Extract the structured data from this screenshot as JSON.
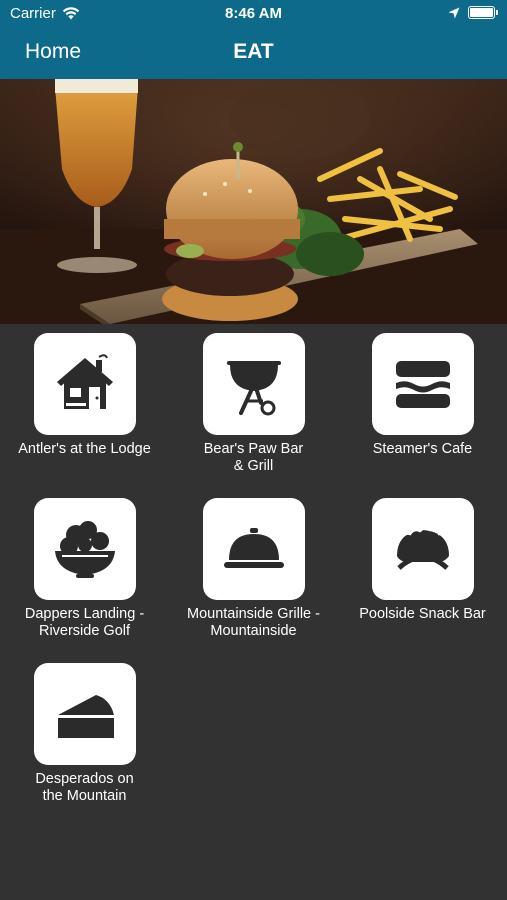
{
  "status_bar": {
    "carrier": "Carrier",
    "time": "8:46 AM"
  },
  "nav": {
    "back_label": "Home",
    "title": "EAT"
  },
  "colors": {
    "nav_bg": "#0e6a8a",
    "page_bg": "#323232",
    "tile_bg": "#ffffff",
    "icon": "#2b2b2b"
  },
  "venues": [
    {
      "label": "Antler's at the Lodge",
      "icon": "lodge-house-icon"
    },
    {
      "label": "Bear's Paw Bar\n& Grill",
      "icon": "grill-icon"
    },
    {
      "label": "Steamer's Cafe",
      "icon": "sandwich-icon"
    },
    {
      "label": "Dappers Landing -\nRiverside Golf",
      "icon": "salad-bowl-icon"
    },
    {
      "label": "Mountainside Grille -\nMountainside",
      "icon": "serving-cloche-icon"
    },
    {
      "label": "Poolside Snack Bar",
      "icon": "taco-icon"
    },
    {
      "label": "Desperados on\nthe Mountain",
      "icon": "pie-slice-icon"
    }
  ]
}
